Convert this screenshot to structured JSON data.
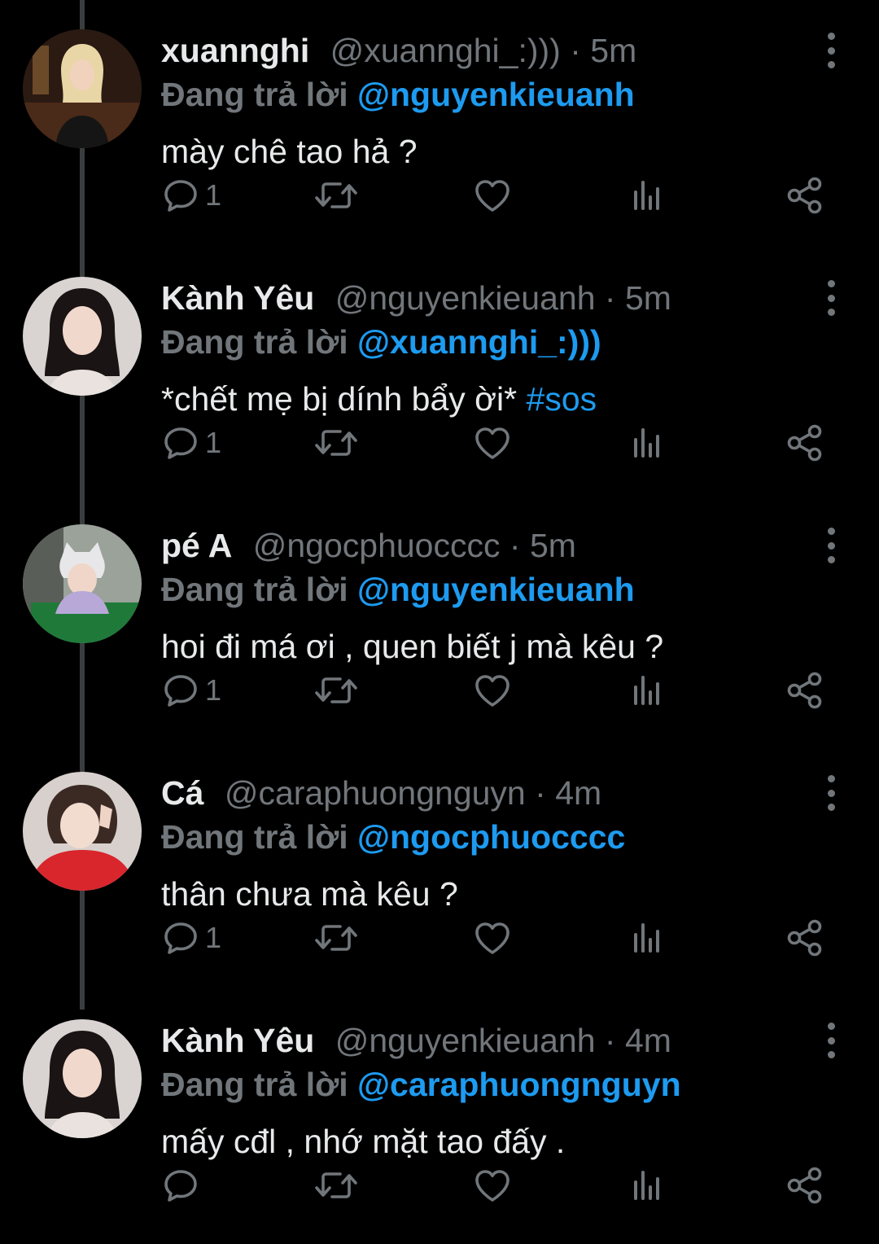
{
  "accent_color": "#1d9bf0",
  "muted_color": "#71767b",
  "tweets": [
    {
      "name": "xuannghi",
      "handle": "@xuannghi_:)))",
      "separator": "·",
      "time": "5m",
      "reply_prefix": "Đang trả lời",
      "reply_to": "@nguyenkieuanh",
      "text": "mày chê tao hả ?",
      "hashtag": "",
      "reply_count": "1",
      "icons": [
        "reply-icon",
        "retweet-icon",
        "like-icon",
        "views-icon",
        "share-icon",
        "more-icon"
      ]
    },
    {
      "name": "Kành Yêu",
      "handle": "@nguyenkieuanh",
      "separator": "·",
      "time": "5m",
      "reply_prefix": "Đang trả lời",
      "reply_to": "@xuannghi_:)))",
      "text": "*chết mẹ bị dính bẩy ời*",
      "hashtag": "#sos",
      "reply_count": "1"
    },
    {
      "name": "pé A",
      "handle": "@ngocphuocccc",
      "separator": "·",
      "time": "5m",
      "reply_prefix": "Đang trả lời",
      "reply_to": "@nguyenkieuanh",
      "text": "hoi đi má ơi , quen biết j mà kêu ?",
      "hashtag": "",
      "reply_count": "1"
    },
    {
      "name": "Cá",
      "handle": "@caraphuongnguyn",
      "separator": "·",
      "time": "4m",
      "reply_prefix": "Đang trả lời",
      "reply_to": "@ngocphuocccc",
      "text": "thân chưa mà kêu ?",
      "hashtag": "",
      "reply_count": "1"
    },
    {
      "name": "Kành Yêu",
      "handle": "@nguyenkieuanh",
      "separator": "·",
      "time": "4m",
      "reply_prefix": "Đang trả lời",
      "reply_to": "@caraphuongnguyn",
      "text": "mấy cđl , nhớ mặt tao đấy .",
      "hashtag": "",
      "reply_count": ""
    }
  ]
}
